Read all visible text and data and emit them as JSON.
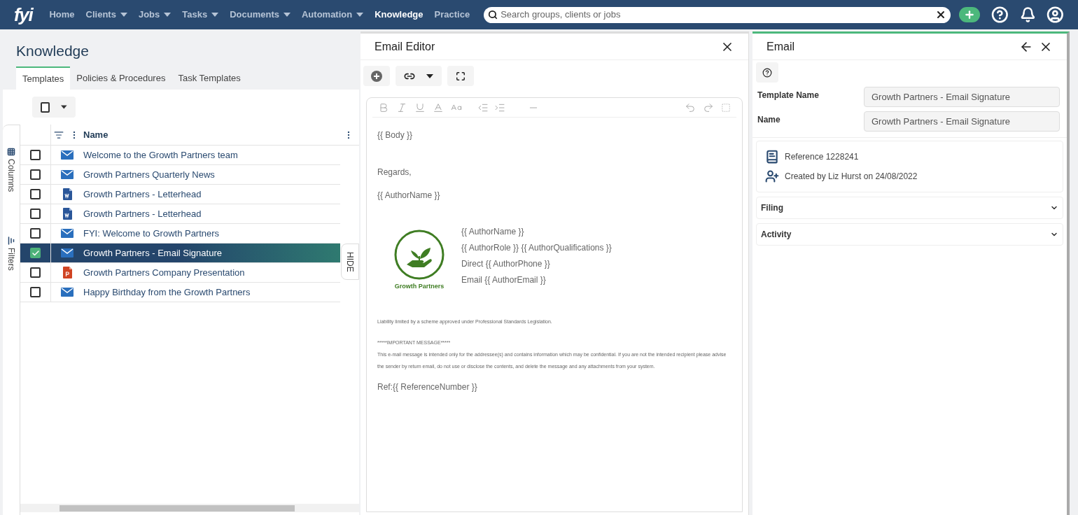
{
  "nav": {
    "logo": "fyi",
    "items": [
      {
        "label": "Home",
        "has_menu": false,
        "selected": false
      },
      {
        "label": "Clients",
        "has_menu": true,
        "selected": false
      },
      {
        "label": "Jobs",
        "has_menu": true,
        "selected": false
      },
      {
        "label": "Tasks",
        "has_menu": true,
        "selected": false
      },
      {
        "label": "Documents",
        "has_menu": true,
        "selected": false
      },
      {
        "label": "Automation",
        "has_menu": true,
        "selected": false
      },
      {
        "label": "Knowledge",
        "has_menu": false,
        "selected": true
      },
      {
        "label": "Practice",
        "has_menu": false,
        "selected": false
      }
    ],
    "search": {
      "placeholder": "Search groups, clients or jobs"
    }
  },
  "knowledge": {
    "title": "Knowledge",
    "tabs": [
      {
        "label": "Templates",
        "selected": true
      },
      {
        "label": "Policies & Procedures",
        "selected": false
      },
      {
        "label": "Task Templates",
        "selected": false
      }
    ],
    "side_tabs": [
      "Columns",
      "Filters"
    ],
    "hide_tab": "HIDE",
    "select_all_checked": false,
    "table": {
      "columns": [
        "Name"
      ],
      "rows": [
        {
          "name": "Welcome to the Growth Partners team",
          "kind": "email",
          "checked": false,
          "selected": false
        },
        {
          "name": "Growth Partners Quarterly News",
          "kind": "email",
          "checked": false,
          "selected": false
        },
        {
          "name": "Growth Partners - Letterhead",
          "kind": "word",
          "checked": false,
          "selected": false
        },
        {
          "name": "Growth Partners - Letterhead",
          "kind": "word",
          "checked": false,
          "selected": false
        },
        {
          "name": "FYI: Welcome to Growth Partners",
          "kind": "email",
          "checked": false,
          "selected": false
        },
        {
          "name": "Growth Partners - Email Signature",
          "kind": "email",
          "checked": true,
          "selected": true
        },
        {
          "name": "Growth Partners Company Presentation",
          "kind": "powerpoint",
          "checked": false,
          "selected": false
        },
        {
          "name": "Happy Birthday from the Growth Partners",
          "kind": "email",
          "checked": false,
          "selected": false
        }
      ]
    }
  },
  "editor": {
    "title": "Email Editor",
    "body": "{{ Body }}",
    "closing": "Regards,",
    "author": "{{ AuthorName }}",
    "signature": {
      "logo_caption": "Growth Partners",
      "lines": [
        "{{ AuthorName }}",
        "{{ AuthorRole }} {{ AuthorQualifications }}",
        "Direct {{ AuthorPhone }}",
        "Email {{ AuthorEmail }}"
      ]
    },
    "liability": "Liability limited by a scheme approved under Professional Standards Legislation.",
    "notice_heading": "*****IMPORTANT MESSAGE*****",
    "notice": "This e-mail message is intended only for the addressee(s) and contains information which may be confidential.  If you are not the intended recipient please advise the sender by return email, do not use or disclose the contents, and delete the message and any attachments from your system.",
    "ref": "Ref:{{ ReferenceNumber }}"
  },
  "details": {
    "title": "Email",
    "fields": [
      {
        "label": "Template Name",
        "value": "Growth Partners - Email Signature"
      },
      {
        "label": "Name",
        "value": "Growth Partners - Email Signature"
      }
    ],
    "info": [
      {
        "kind": "reference",
        "text": "Reference 1228241"
      },
      {
        "kind": "created",
        "text": "Created by Liz Hurst on 24/08/2022"
      }
    ],
    "sections": [
      {
        "label": "Filing",
        "expanded": false
      },
      {
        "label": "Activity",
        "expanded": false
      }
    ]
  }
}
